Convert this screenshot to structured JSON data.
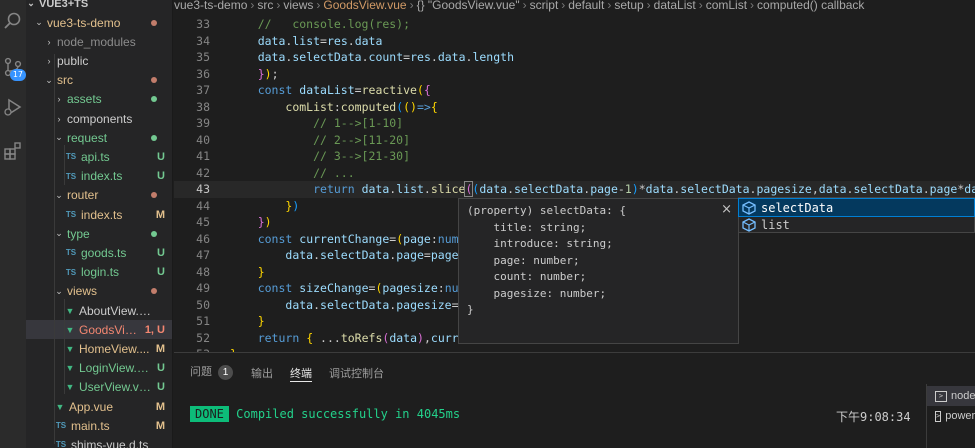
{
  "activity_bar": {
    "scm_badge": "17"
  },
  "sidebar": {
    "section_title": "VUE3+TS",
    "rows": [
      {
        "label": "vue3-ts-demo",
        "status": "",
        "kind": "folder-open",
        "color": "#e2c08d"
      },
      {
        "label": "node_modules",
        "status": "",
        "kind": "folder",
        "color": "#8c8c8c"
      },
      {
        "label": "public",
        "status": "",
        "kind": "folder",
        "color": "#cccccc"
      },
      {
        "label": "src",
        "status": "",
        "kind": "folder-open",
        "color": "#e2c08d"
      },
      {
        "label": "assets",
        "status": "",
        "kind": "folder",
        "color": "#73c991"
      },
      {
        "label": "components",
        "status": "",
        "kind": "folder",
        "color": "#cccccc"
      },
      {
        "label": "request",
        "status": "",
        "kind": "folder-open",
        "color": "#73c991"
      },
      {
        "label": "api.ts",
        "status": "U",
        "kind": "ts",
        "color": "#73c991"
      },
      {
        "label": "index.ts",
        "status": "U",
        "kind": "ts",
        "color": "#73c991"
      },
      {
        "label": "router",
        "status": "",
        "kind": "folder-open",
        "color": "#e2c08d"
      },
      {
        "label": "index.ts",
        "status": "M",
        "kind": "ts",
        "color": "#e2c08d"
      },
      {
        "label": "type",
        "status": "",
        "kind": "folder-open",
        "color": "#73c991"
      },
      {
        "label": "goods.ts",
        "status": "U",
        "kind": "ts",
        "color": "#73c991"
      },
      {
        "label": "login.ts",
        "status": "U",
        "kind": "ts",
        "color": "#73c991"
      },
      {
        "label": "views",
        "status": "",
        "kind": "folder-open",
        "color": "#e2c08d"
      },
      {
        "label": "AboutView.vue",
        "status": "",
        "kind": "vue",
        "color": "#cccccc"
      },
      {
        "label": "GoodsVie...",
        "status": "1, U",
        "kind": "vue",
        "color": "#f48771"
      },
      {
        "label": "HomeView....",
        "status": "M",
        "kind": "vue",
        "color": "#e2c08d"
      },
      {
        "label": "LoginView.vue",
        "status": "U",
        "kind": "vue",
        "color": "#73c991"
      },
      {
        "label": "UserView.vue",
        "status": "U",
        "kind": "vue",
        "color": "#73c991"
      },
      {
        "label": "App.vue",
        "status": "M",
        "kind": "vue",
        "color": "#e2c08d"
      },
      {
        "label": "main.ts",
        "status": "M",
        "kind": "ts",
        "color": "#e2c08d"
      },
      {
        "label": "shims-vue.d.ts",
        "status": "",
        "kind": "ts",
        "color": "#cccccc"
      }
    ]
  },
  "breadcrumb": [
    "vue3-ts-demo",
    "src",
    "views",
    "GoodsView.vue",
    "{} \"GoodsView.vue\"",
    "script",
    "default",
    "setup",
    "dataList",
    "comList",
    "computed() callback"
  ],
  "editor": {
    "current_line": "43",
    "line_numbers": [
      "33",
      "34",
      "35",
      "36",
      "37",
      "38",
      "39",
      "40",
      "41",
      "42",
      "43",
      "44",
      "45",
      "46",
      "47",
      "48",
      "49",
      "50",
      "51",
      "52",
      "53"
    ]
  },
  "hover": {
    "close": "×",
    "lines": [
      "(property) selectData: {",
      "    title: string;",
      "    introduce: string;",
      "    page: number;",
      "    count: number;",
      "    pagesize: number;",
      "}"
    ]
  },
  "suggest": {
    "items": [
      "selectData",
      "list"
    ]
  },
  "panel": {
    "tabs": [
      "问题",
      "输出",
      "终端",
      "调试控制台"
    ],
    "problems_count": "1",
    "active_tab": "终端",
    "terminal": {
      "badge": "DONE",
      "message": "Compiled successfully in 4045ms",
      "time": "下午9:08:34"
    },
    "terminals": [
      "node",
      "powershell"
    ]
  }
}
